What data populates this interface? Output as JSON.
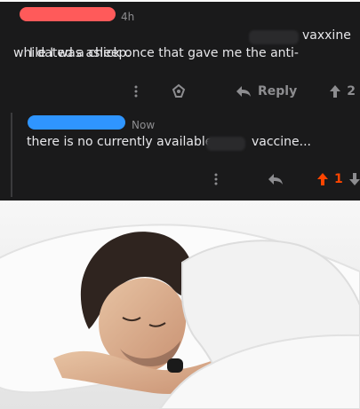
{
  "comment1": {
    "time": "4h",
    "text_line1": "I dated a chick once that gave me the anti-",
    "text_end1": "vaxxine",
    "text_line2": "while I was asleep.",
    "reply_label": "Reply",
    "score": "2"
  },
  "comment2": {
    "time": "Now",
    "text_start": "there is no currently available",
    "text_end": "vaccine...",
    "score": "1"
  },
  "colors": {
    "background": "#1a1a1b",
    "text": "#e7e7ea",
    "meta": "#8d8d90",
    "upvote_active": "#ff4500",
    "redact_red": "#ff5a5a",
    "redact_blue": "#2f95ff"
  }
}
